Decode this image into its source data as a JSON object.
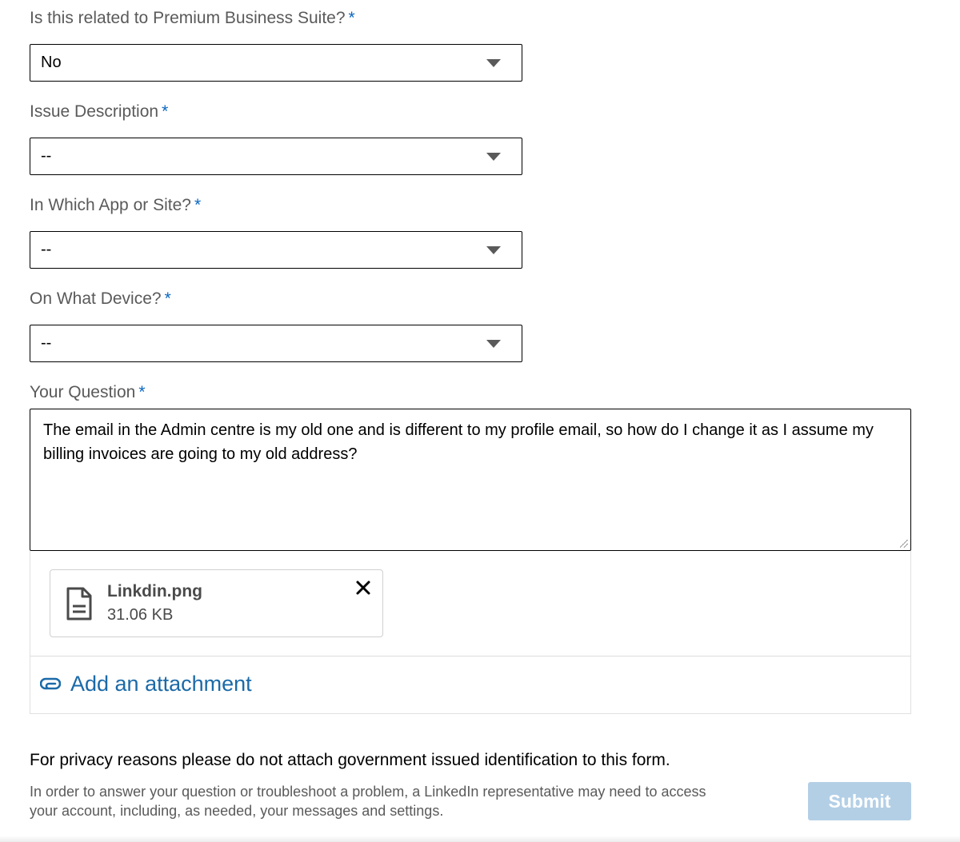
{
  "form": {
    "premium": {
      "label": "Is this related to Premium Business Suite?",
      "required_mark": "*",
      "value": "No"
    },
    "issue": {
      "label": "Issue Description",
      "required_mark": "*",
      "value": "--"
    },
    "app": {
      "label": "In Which App or Site?",
      "required_mark": "*",
      "value": "--"
    },
    "device": {
      "label": "On What Device?",
      "required_mark": "*",
      "value": "--"
    },
    "question": {
      "label": "Your Question",
      "required_mark": "*",
      "value": "The email in the Admin centre is my old one and is different to my profile email, so how do I change it as I assume my billing invoices are going to my old address?"
    }
  },
  "attachment": {
    "file_name": "Linkdin.png",
    "file_size": "31.06 KB",
    "add_label": "Add an attachment",
    "icons": {
      "file": "document-icon",
      "close": "close-icon",
      "add": "paperclip-icon"
    }
  },
  "notice": {
    "privacy": "For privacy reasons please do not attach government issued identification to this form.",
    "disclaimer": "In order to answer your question or troubleshoot a problem, a LinkedIn representative may need to access your account, including, as needed, your messages and settings."
  },
  "actions": {
    "submit_label": "Submit"
  },
  "colors": {
    "accent": "#0a66c2",
    "link": "#1b6aa8",
    "submit_disabled": "#b3cfe6"
  }
}
